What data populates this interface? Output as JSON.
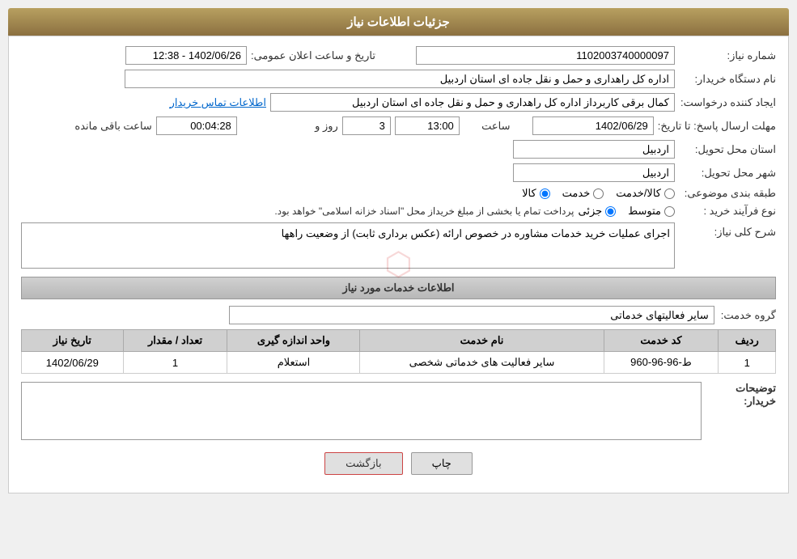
{
  "header": {
    "title": "جزئیات اطلاعات نیاز"
  },
  "form": {
    "shomareNiaz_label": "شماره نیاز:",
    "shomareNiaz_value": "1102003740000097",
    "tarikh_label": "تاریخ و ساعت اعلان عمومی:",
    "tarikh_value": "1402/06/26 - 12:38",
    "namDastgah_label": "نام دستگاه خریدار:",
    "namDastgah_value": "اداره کل راهداری و حمل و نقل جاده ای استان اردبیل",
    "ijadKonande_label": "ایجاد کننده درخواست:",
    "ijadKonande_value": "کمال برقی کاربرداز اداره کل راهداری و حمل و نقل جاده ای استان اردبیل",
    "etelaatTamas_link": "اطلاعات تماس خریدار",
    "mohlat_label": "مهلت ارسال پاسخ: تا تاریخ:",
    "mohlat_date": "1402/06/29",
    "mohlat_time": "13:00",
    "mohlat_days_label": "روز و",
    "mohlat_days": "3",
    "mohlat_remaining_label": "ساعت باقی مانده",
    "mohlat_remaining": "00:04:28",
    "ostan_label": "استان محل تحویل:",
    "ostan_value": "اردبیل",
    "shahr_label": "شهر محل تحویل:",
    "shahr_value": "اردبیل",
    "tabaqe_label": "طبقه بندی موضوعی:",
    "tabaqe_options": [
      "کالا",
      "خدمت",
      "کالا/خدمت"
    ],
    "tabaqe_selected": "کالا",
    "noeFarayand_label": "نوع فرآیند خرید :",
    "noeFarayand_options": [
      "جزئی",
      "متوسط"
    ],
    "noeFarayand_note": "پرداخت تمام یا بخشی از مبلغ خریداز محل \"اسناد خزانه اسلامی\" خواهد بود.",
    "sharhKoli_label": "شرح کلی نیاز:",
    "sharhKoli_value": "اجرای عملیات خرید خدمات مشاوره در خصوص ارائه (عکس برداری ثابت) از وضعیت راهها",
    "khadamat_section_title": "اطلاعات خدمات مورد نیاز",
    "groheKhadamat_label": "گروه خدمت:",
    "groheKhadamat_value": "سایر فعالیتهای خدماتی",
    "table": {
      "headers": [
        "ردیف",
        "کد خدمت",
        "نام خدمت",
        "واحد اندازه گیری",
        "تعداد / مقدار",
        "تاریخ نیاز"
      ],
      "rows": [
        {
          "radif": "1",
          "kodKhadamat": "ط-96-96-960",
          "namKhadamat": "سایر فعالیت های خدماتی شخصی",
          "vahed": "استعلام",
          "tedad": "1",
          "tarikh": "1402/06/29"
        }
      ]
    },
    "tosihKharidar_label": "توضیحات خریدار:",
    "tosihKharidar_value": ""
  },
  "buttons": {
    "print_label": "چاپ",
    "back_label": "بازگشت"
  }
}
